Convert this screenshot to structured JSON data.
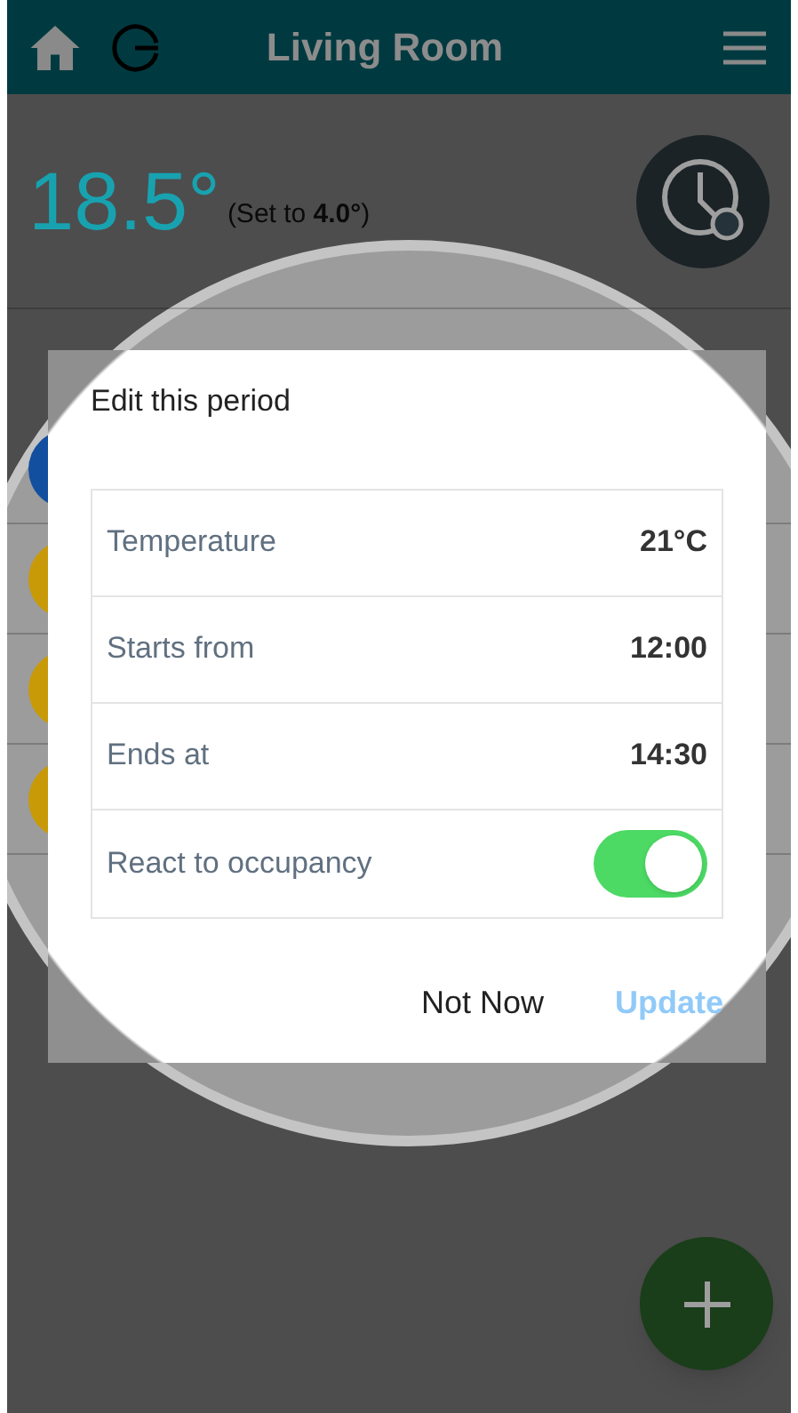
{
  "header": {
    "title": "Living Room"
  },
  "current": {
    "temperature": "18.5°",
    "setpoint": "(Set to **4.0°**)"
  },
  "periods": [
    {
      "color": "#124f9e"
    },
    {
      "color": "#c89a08"
    },
    {
      "color": "#c89a08"
    },
    {
      "color": "#c89a08"
    }
  ],
  "dialog": {
    "title": "Edit this period",
    "fields": [
      {
        "kind": "value",
        "label": "Temperature",
        "value": "21°C"
      },
      {
        "kind": "value",
        "label": "Starts from",
        "value": "12:00"
      },
      {
        "kind": "value",
        "label": "Ends at",
        "value": "14:30"
      },
      {
        "kind": "toggle",
        "label": "React to occupancy",
        "on": true
      }
    ],
    "buttons": [
      {
        "label": "Not Now",
        "primary": false
      },
      {
        "label": "Update",
        "primary": true
      }
    ]
  }
}
